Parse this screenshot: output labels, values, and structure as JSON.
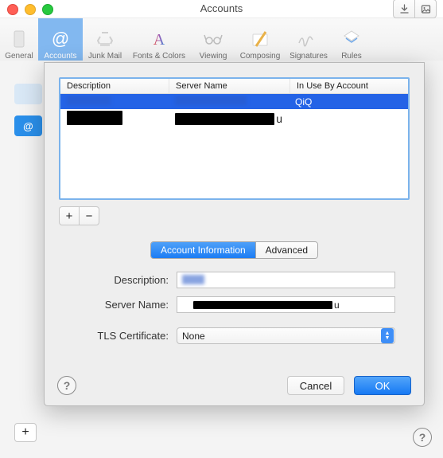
{
  "window": {
    "title": "Accounts"
  },
  "toolbar": [
    {
      "id": "general",
      "label": "General"
    },
    {
      "id": "accounts",
      "label": "Accounts",
      "selected": true
    },
    {
      "id": "junkmail",
      "label": "Junk Mail"
    },
    {
      "id": "fonts",
      "label": "Fonts & Colors"
    },
    {
      "id": "viewing",
      "label": "Viewing"
    },
    {
      "id": "composing",
      "label": "Composing"
    },
    {
      "id": "signatures",
      "label": "Signatures"
    },
    {
      "id": "rules",
      "label": "Rules"
    }
  ],
  "table": {
    "columns": {
      "description": "Description",
      "server": "Server Name",
      "inuse": "In Use By Account"
    },
    "rows": [
      {
        "description": "(redacted)",
        "server": "(redacted)",
        "inuse": "QiQ",
        "selected": true
      },
      {
        "description": "(redacted)",
        "server": "(redacted)",
        "inuse_suffix": "u",
        "selected": false
      }
    ]
  },
  "tabs": {
    "info": "Account Information",
    "advanced": "Advanced",
    "active": "info"
  },
  "form": {
    "description_label": "Description:",
    "description_value": "(redacted)",
    "server_label": "Server Name:",
    "server_value": "(redacted)",
    "server_suffix": "u",
    "tls_label": "TLS Certificate:",
    "tls_value": "None"
  },
  "buttons": {
    "cancel": "Cancel",
    "ok": "OK"
  },
  "glyphs": {
    "plus": "+",
    "minus": "−",
    "help": "?",
    "at": "@"
  }
}
